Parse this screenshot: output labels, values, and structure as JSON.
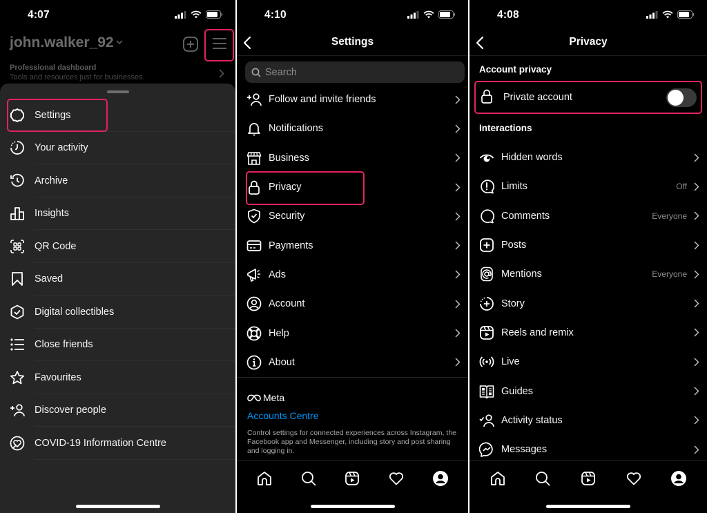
{
  "colors": {
    "highlight": "#e0245e",
    "link": "#0095f6",
    "sheet_bg": "#262626",
    "bg": "#000000"
  },
  "panel1": {
    "status_time": "4:07",
    "username": "john.walker_92",
    "icons": {
      "add": "plus-square-icon",
      "menu": "hamburger-menu-icon",
      "caret": "chevron-down-icon"
    },
    "dashboard": {
      "title": "Professional dashboard",
      "subtitle": "Tools and resources just for businesses."
    },
    "menu": [
      {
        "label": "Settings",
        "icon": "gear-icon",
        "highlighted": true
      },
      {
        "label": "Your activity",
        "icon": "activity-clock-icon"
      },
      {
        "label": "Archive",
        "icon": "archive-history-icon"
      },
      {
        "label": "Insights",
        "icon": "bar-chart-icon"
      },
      {
        "label": "QR Code",
        "icon": "qr-code-icon"
      },
      {
        "label": "Saved",
        "icon": "bookmark-icon"
      },
      {
        "label": "Digital collectibles",
        "icon": "hexagon-check-icon"
      },
      {
        "label": "Close friends",
        "icon": "star-list-icon"
      },
      {
        "label": "Favourites",
        "icon": "star-icon"
      },
      {
        "label": "Discover people",
        "icon": "add-person-icon"
      },
      {
        "label": "COVID-19 Information Centre",
        "icon": "heart-circle-icon"
      }
    ]
  },
  "panel2": {
    "status_time": "4:10",
    "title": "Settings",
    "search_placeholder": "Search",
    "items": [
      {
        "label": "Follow and invite friends",
        "icon": "add-person-icon"
      },
      {
        "label": "Notifications",
        "icon": "bell-icon"
      },
      {
        "label": "Business",
        "icon": "store-icon"
      },
      {
        "label": "Privacy",
        "icon": "lock-icon",
        "highlighted": true
      },
      {
        "label": "Security",
        "icon": "shield-check-icon"
      },
      {
        "label": "Payments",
        "icon": "credit-card-icon"
      },
      {
        "label": "Ads",
        "icon": "megaphone-icon"
      },
      {
        "label": "Account",
        "icon": "account-circle-icon"
      },
      {
        "label": "Help",
        "icon": "lifebuoy-icon"
      },
      {
        "label": "About",
        "icon": "info-icon"
      }
    ],
    "meta_label": "Meta",
    "accounts_centre": "Accounts Centre",
    "accounts_centre_desc": "Control settings for connected experiences across Instagram, the Facebook app and Messenger, including story and post sharing and logging in."
  },
  "panel3": {
    "status_time": "4:08",
    "title": "Privacy",
    "account_privacy_heading": "Account privacy",
    "private_account": {
      "label": "Private account",
      "enabled": false,
      "highlighted": true
    },
    "interactions_heading": "Interactions",
    "items": [
      {
        "label": "Hidden words",
        "value": "",
        "icon": "hidden-eye-icon"
      },
      {
        "label": "Limits",
        "value": "Off",
        "icon": "limits-bubble-icon"
      },
      {
        "label": "Comments",
        "value": "Everyone",
        "icon": "comment-icon"
      },
      {
        "label": "Posts",
        "value": "",
        "icon": "plus-square-icon"
      },
      {
        "label": "Mentions",
        "value": "Everyone",
        "icon": "at-sign-icon"
      },
      {
        "label": "Story",
        "value": "",
        "icon": "story-add-icon"
      },
      {
        "label": "Reels and remix",
        "value": "",
        "icon": "reels-icon"
      },
      {
        "label": "Live",
        "value": "",
        "icon": "live-broadcast-icon"
      },
      {
        "label": "Guides",
        "value": "",
        "icon": "guide-book-icon"
      },
      {
        "label": "Activity status",
        "value": "",
        "icon": "activity-status-icon"
      },
      {
        "label": "Messages",
        "value": "",
        "icon": "messenger-icon"
      }
    ]
  },
  "tabbar": [
    "home-icon",
    "search-icon",
    "reels-icon",
    "heart-icon",
    "profile-icon"
  ]
}
